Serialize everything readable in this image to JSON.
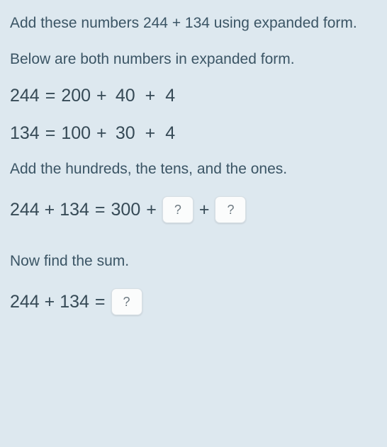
{
  "intro": "Add these numbers 244 + 134 using expanded form.",
  "subhead": "Below are both numbers in expanded form.",
  "expanded1": {
    "num": "244",
    "eq": "=",
    "h": "200",
    "p1": "+",
    "t": "40",
    "p2": "+",
    "o": "4"
  },
  "expanded2": {
    "num": "134",
    "eq": "=",
    "h": "100",
    "p1": "+",
    "t": "30",
    "p2": "+",
    "o": "4"
  },
  "instr1": "Add the hundreds, the tens, and the ones.",
  "sumline": {
    "lhs": "244 + 134",
    "eq": "=",
    "h": "300",
    "p1": "+",
    "p2": "+"
  },
  "instr2": "Now find the sum.",
  "finalline": {
    "lhs": "244 + 134",
    "eq": "="
  },
  "placeholder": "?"
}
